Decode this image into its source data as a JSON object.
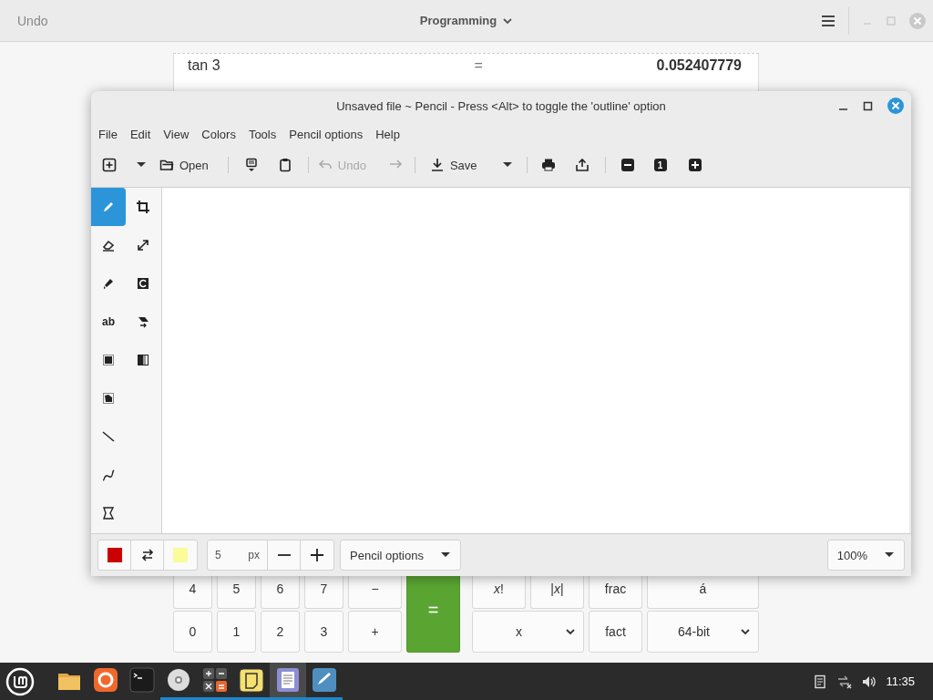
{
  "calculator": {
    "header": {
      "undo": {
        "label": "Undo",
        "disabled": true
      },
      "mode": "Programming"
    },
    "history": [
      {
        "expression": "tan 3",
        "operator": "=",
        "result": "0.052407779"
      }
    ],
    "keypad_left": [
      {
        "label": "4",
        "kind": "key"
      },
      {
        "label": "5",
        "kind": "key"
      },
      {
        "label": "6",
        "kind": "key"
      },
      {
        "label": "7",
        "kind": "key"
      },
      {
        "label": "−",
        "kind": "key"
      },
      {
        "label": "=",
        "kind": "equals"
      },
      {
        "label": "0",
        "kind": "key"
      },
      {
        "label": "1",
        "kind": "key"
      },
      {
        "label": "2",
        "kind": "key"
      },
      {
        "label": "3",
        "kind": "key"
      },
      {
        "label": "+",
        "kind": "key"
      }
    ],
    "keypad_right": [
      {
        "label": "*x*!",
        "kind": "key"
      },
      {
        "label": "|*x*|",
        "kind": "key"
      },
      {
        "label": "frac",
        "kind": "key"
      },
      {
        "label": "á",
        "kind": "key"
      },
      {
        "label": "x",
        "kind": "wide-dropdown"
      },
      {
        "label": "fact",
        "kind": "key"
      },
      {
        "label": "64-bit",
        "kind": "dropdown"
      }
    ]
  },
  "pencil": {
    "title": "Unsaved file ~ Pencil - Press <Alt> to toggle the 'outline' option",
    "menu": [
      "File",
      "Edit",
      "View",
      "Colors",
      "Tools",
      "Pencil options",
      "Help"
    ],
    "toolbar": {
      "open": "Open",
      "undo": {
        "label": "Undo",
        "disabled": true
      },
      "redo": {
        "disabled": true
      },
      "save": "Save",
      "zoom_reset": "1"
    },
    "tools": [
      {
        "selected": true
      },
      {
        "selected": false
      },
      {
        "selected": false
      },
      {
        "selected": false,
        "glyph": "ab"
      },
      {
        "selected": false
      },
      {
        "selected": false
      },
      {
        "selected": false
      },
      {
        "selected": false
      },
      {
        "selected": false
      },
      {
        "selected": false
      },
      {
        "selected": false
      },
      {
        "selected": false
      },
      {
        "selected": false
      },
      {
        "selected": false
      }
    ],
    "bottom": {
      "swatches": [
        {
          "color": "#cc0000"
        },
        {
          "color": "#fbfb9a"
        }
      ],
      "size": "5",
      "unit": "px",
      "options": "Pencil options",
      "zoom": "100%"
    }
  },
  "taskbar": {
    "apps": [
      {
        "running": false,
        "selected": false
      },
      {
        "running": false,
        "selected": false
      },
      {
        "running": false,
        "selected": false
      },
      {
        "running": true,
        "selected": false
      },
      {
        "running": true,
        "selected": false
      },
      {
        "running": true,
        "selected": false
      },
      {
        "running": true,
        "selected": true
      },
      {
        "running": true,
        "selected": false
      }
    ],
    "clock": "11:35"
  }
}
